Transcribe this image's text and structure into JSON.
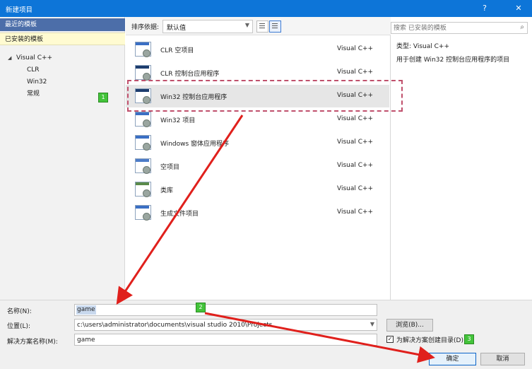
{
  "window": {
    "title": "新建项目",
    "help_glyph": "?",
    "close_glyph": "✕"
  },
  "left": {
    "recent_label": "最近的模板",
    "installed_label": "已安装的模板",
    "tree": [
      {
        "label": "Visual C++",
        "expanded": true
      },
      {
        "label": "CLR"
      },
      {
        "label": "Win32"
      },
      {
        "label": "常规"
      }
    ]
  },
  "toolbar": {
    "sort_label": "排序依据:",
    "sort_value": "默认值"
  },
  "templates": [
    {
      "name": "CLR 空项目",
      "lang": "Visual C++"
    },
    {
      "name": "CLR 控制台应用程序",
      "lang": "Visual C++"
    },
    {
      "name": "Win32 控制台应用程序",
      "lang": "Visual C++",
      "selected": true
    },
    {
      "name": "Win32 项目",
      "lang": "Visual C++"
    },
    {
      "name": "Windows 窗体应用程序",
      "lang": "Visual C++"
    },
    {
      "name": "空项目",
      "lang": "Visual C++"
    },
    {
      "name": "类库",
      "lang": "Visual C++"
    },
    {
      "name": "生成文件项目",
      "lang": "Visual C++"
    }
  ],
  "right": {
    "search_placeholder": "搜索 已安装的模板",
    "type_line": "类型:  Visual C++",
    "description": "用于创建 Win32 控制台应用程序的项目"
  },
  "form": {
    "name_label": "名称(N):",
    "name_value": "game",
    "location_label": "位置(L):",
    "location_value": "c:\\users\\administrator\\documents\\visual studio 2010\\Projects",
    "solution_label": "解决方案名称(M):",
    "solution_value": "game",
    "browse_label": "浏览(B)...",
    "create_dir_label": "为解决方案创建目录(D)",
    "create_dir_checked": true,
    "ok_label": "确定",
    "cancel_label": "取消"
  },
  "annotations": {
    "step1": "1",
    "step2": "2",
    "step3": "3"
  },
  "colors": {
    "titlebar": "#0d75d8",
    "recent_header": "#4c6ea9",
    "installed_header": "#fffbd1",
    "annotation_green": "#43c33a",
    "annotation_arrow": "#e0201c"
  }
}
